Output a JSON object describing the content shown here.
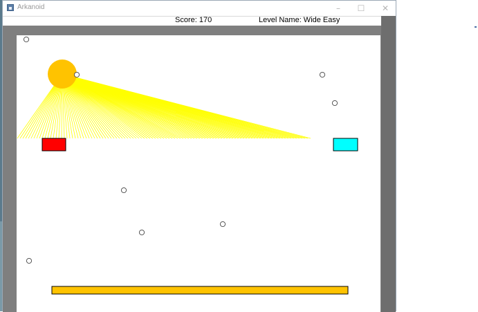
{
  "window": {
    "title": "Arkanoid",
    "controls": {
      "minimize": "–",
      "maximize": "☐",
      "close": "✕"
    }
  },
  "hud": {
    "score_text": "Score: 170",
    "level_text": "Level Name: Wide Easy"
  },
  "icons": [
    "app-icon",
    "minimize-icon",
    "maximize-icon",
    "close-icon"
  ],
  "colors": {
    "border": "#7f7f7f",
    "background": "#ffffff",
    "sun": "#ffc300",
    "sun_rays": "#ffff00",
    "left_block": "#ff0000",
    "right_block": "#00ffff",
    "paddle": "#ffc300",
    "ball_fill": "#ffffff",
    "ball_stroke": "#444444"
  },
  "game": {
    "ball_count": 8
  }
}
